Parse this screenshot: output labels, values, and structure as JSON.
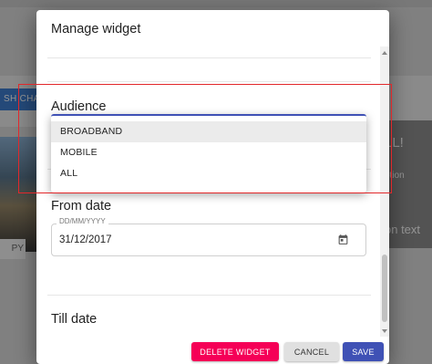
{
  "background": {
    "publish_label": "SH CHAN",
    "copy_label": "PY",
    "card_text_1": "LL!",
    "card_text_2": "ption",
    "card_text_3": "on text"
  },
  "dialog": {
    "title": "Manage widget",
    "audience_label": "Audience",
    "audience_options": [
      "BROADBAND",
      "MOBILE",
      "ALL"
    ],
    "audience_highlighted": "BROADBAND",
    "from_date_label": "From date",
    "from_date_placeholder": "DD/MM/YYYY",
    "from_date_value": "31/12/2017",
    "till_date_label": "Till date"
  },
  "actions": {
    "delete_label": "DELETE WIDGET",
    "cancel_label": "CANCEL",
    "save_label": "SAVE"
  },
  "icons": {
    "calendar": "calendar-icon"
  },
  "colors": {
    "delete_button": "#f50057",
    "cancel_button": "#e0e0e0",
    "save_button": "#3f51b5",
    "highlight_box": "#e2282b",
    "focus_underline": "#3f51b5"
  }
}
